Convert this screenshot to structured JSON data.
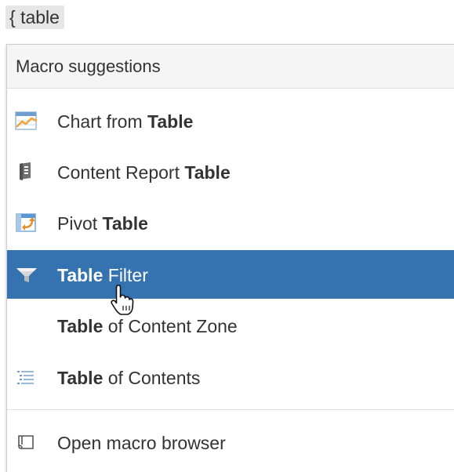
{
  "query": {
    "text": "{ table"
  },
  "dropdown": {
    "header": "Macro suggestions",
    "items": [
      {
        "pre": "Chart from ",
        "match": "Table",
        "post": "",
        "icon": "chart-icon",
        "selected": false
      },
      {
        "pre": "Content Report ",
        "match": "Table",
        "post": "",
        "icon": "content-report-icon",
        "selected": false
      },
      {
        "pre": "Pivot ",
        "match": "Table",
        "post": "",
        "icon": "pivot-table-icon",
        "selected": false
      },
      {
        "pre": "",
        "match": "Table",
        "post": " Filter",
        "icon": "filter-icon",
        "selected": true
      },
      {
        "pre": "",
        "match": "Table",
        "post": " of Content Zone",
        "icon": "",
        "selected": false
      },
      {
        "pre": "",
        "match": "Table",
        "post": " of Contents",
        "icon": "table-of-contents-icon",
        "selected": false
      }
    ],
    "footer": {
      "label": "Open macro browser",
      "icon": "macro-browser-icon"
    }
  },
  "colors": {
    "selected_bg": "#3572b0",
    "header_bg": "#f5f5f5",
    "chip_bg": "#e6e6e6"
  }
}
